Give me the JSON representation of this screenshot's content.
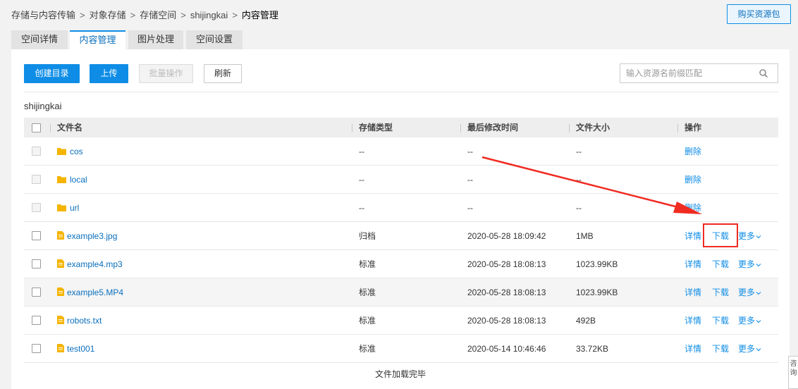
{
  "breadcrumb": [
    "存储与内容传输",
    "对象存储",
    "存储空间",
    "shijingkai",
    "内容管理"
  ],
  "breadcrumb_separator": ">",
  "buy_button": "购买资源包",
  "tabs": [
    {
      "label": "空间详情",
      "active": false
    },
    {
      "label": "内容管理",
      "active": true
    },
    {
      "label": "图片处理",
      "active": false
    },
    {
      "label": "空间设置",
      "active": false
    }
  ],
  "toolbar": {
    "create_dir": "创建目录",
    "upload": "上传",
    "batch": "批量操作",
    "refresh": "刷新"
  },
  "search": {
    "placeholder": "输入资源名前缀匹配",
    "value": ""
  },
  "current_path": "shijingkai",
  "columns": [
    "文件名",
    "存储类型",
    "最后修改时间",
    "文件大小",
    "操作"
  ],
  "rows": [
    {
      "type": "folder",
      "name": "cos",
      "storage": "--",
      "modified": "--",
      "size": "--",
      "actions": [
        "删除"
      ]
    },
    {
      "type": "folder",
      "name": "local",
      "storage": "--",
      "modified": "--",
      "size": "--",
      "actions": [
        "删除"
      ]
    },
    {
      "type": "folder",
      "name": "url",
      "storage": "--",
      "modified": "--",
      "size": "--",
      "actions": [
        "删除"
      ]
    },
    {
      "type": "file",
      "name": "example3.jpg",
      "storage": "归档",
      "modified": "2020-05-28 18:09:42",
      "size": "1MB",
      "actions": [
        "详情",
        "下载",
        "更多"
      ]
    },
    {
      "type": "file",
      "name": "example4.mp3",
      "storage": "标准",
      "modified": "2020-05-28 18:08:13",
      "size": "1023.99KB",
      "actions": [
        "详情",
        "下载",
        "更多"
      ]
    },
    {
      "type": "file",
      "name": "example5.MP4",
      "storage": "标准",
      "modified": "2020-05-28 18:08:13",
      "size": "1023.99KB",
      "actions": [
        "详情",
        "下载",
        "更多"
      ],
      "highlight": true
    },
    {
      "type": "file",
      "name": "robots.txt",
      "storage": "标准",
      "modified": "2020-05-28 18:08:13",
      "size": "492B",
      "actions": [
        "详情",
        "下载",
        "更多"
      ]
    },
    {
      "type": "file",
      "name": "test001",
      "storage": "标准",
      "modified": "2020-05-14 10:46:46",
      "size": "33.72KB",
      "actions": [
        "详情",
        "下载",
        "更多"
      ]
    }
  ],
  "footer_note": "文件加载完毕",
  "side_widget": "咨询",
  "colors": {
    "accent": "#0f8de6",
    "annotation": "#f02b21",
    "folder": "#f5b400"
  }
}
